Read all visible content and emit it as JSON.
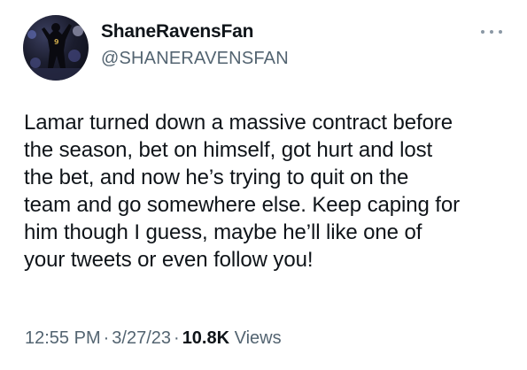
{
  "author": {
    "display_name": "ShaneRavensFan",
    "handle": "@SHANERAVENSFAN",
    "avatar_icon": "avatar-photo"
  },
  "menu": {
    "icon": "more-options-icon",
    "glyph": "···"
  },
  "tweet": {
    "lines": [
      "Lamar turned down a massive contract before",
      "the season, bet on himself, got hurt and lost",
      "the bet, and now he’s trying to quit on the",
      "team and go somewhere else. Keep caping for",
      "him though I guess, maybe he’ll like one of",
      "your tweets or even follow you!"
    ]
  },
  "meta": {
    "time": "12:55 PM",
    "separator": "·",
    "date": "3/27/23",
    "views_count": "10.8K",
    "views_label": "Views"
  },
  "colors": {
    "text_primary": "#0f1419",
    "text_secondary": "#536471",
    "background": "#ffffff"
  }
}
